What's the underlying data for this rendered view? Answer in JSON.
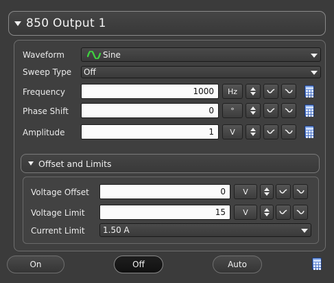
{
  "header": {
    "title": "850 Output 1"
  },
  "waveform": {
    "label": "Waveform",
    "value": "Sine",
    "icon": "sine-wave-icon",
    "icon_color": "#3fd13f"
  },
  "sweep": {
    "label": "Sweep Type",
    "value": "Off"
  },
  "frequency": {
    "label": "Frequency",
    "value": "1000",
    "unit": "Hz"
  },
  "phase": {
    "label": "Phase Shift",
    "value": "0",
    "unit": "°"
  },
  "amplitude": {
    "label": "Amplitude",
    "value": "1",
    "unit": "V"
  },
  "offset_section": {
    "title": "Offset and Limits",
    "voltage_offset": {
      "label": "Voltage Offset",
      "value": "0",
      "unit": "V"
    },
    "voltage_limit": {
      "label": "Voltage Limit",
      "value": "15",
      "unit": "V"
    },
    "current_limit": {
      "label": "Current Limit",
      "value": "1.50 A"
    }
  },
  "footer": {
    "on_label": "On",
    "off_label": "Off",
    "auto_label": "Auto",
    "selected": "Off"
  }
}
